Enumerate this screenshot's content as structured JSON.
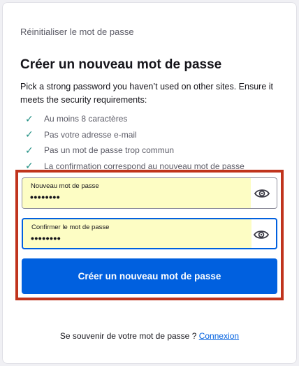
{
  "page": {
    "subtitle": "Réinitialiser le mot de passe",
    "heading": "Créer un nouveau mot de passe",
    "description": "Pick a strong password you haven’t used on other sites. Ensure it meets the security requirements:"
  },
  "requirements": [
    "Au moins 8 caractères",
    "Pas votre adresse e-mail",
    "Pas un mot de passe trop commun",
    "La confirmation correspond au nouveau mot de passe"
  ],
  "fields": {
    "new_password": {
      "label": "Nouveau mot de passe",
      "value": "••••••••"
    },
    "confirm_password": {
      "label": "Confirmer le mot de passe",
      "value": "••••••••"
    }
  },
  "submit_label": "Créer un nouveau mot de passe",
  "footer": {
    "prompt": "Se souvenir de votre mot de passe ? ",
    "link": "Connexion"
  },
  "icons": {
    "check": "check-icon",
    "eye": "eye-icon"
  },
  "colors": {
    "primary": "#0060df",
    "check": "#1f8f83",
    "highlight": "#c0341d",
    "autofill": "#fdfdc4"
  }
}
